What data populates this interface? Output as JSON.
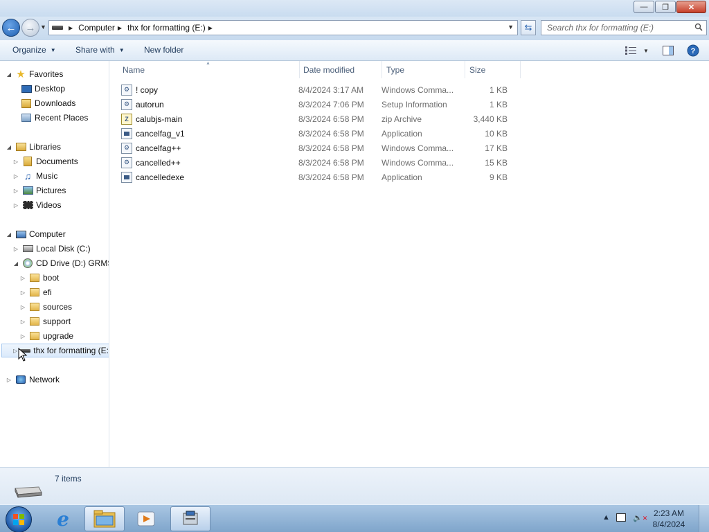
{
  "window": {
    "minimize_glyph": "—",
    "maximize_glyph": "❐",
    "close_glyph": "✕"
  },
  "address": {
    "breadcrumbs": [
      "Computer",
      "thx for formatting (E:)"
    ],
    "search_placeholder": "Search thx for formatting (E:)"
  },
  "toolbar": {
    "organize": "Organize",
    "share_with": "Share with",
    "new_folder": "New folder"
  },
  "nav_tree": {
    "favorites": {
      "label": "Favorites",
      "items": [
        "Desktop",
        "Downloads",
        "Recent Places"
      ]
    },
    "libraries": {
      "label": "Libraries",
      "items": [
        "Documents",
        "Music",
        "Pictures",
        "Videos"
      ]
    },
    "computer": {
      "label": "Computer",
      "local_disk": "Local Disk (C:)",
      "cd_drive": "CD Drive (D:) GRMSX",
      "cd_folders": [
        "boot",
        "efi",
        "sources",
        "support",
        "upgrade"
      ],
      "e_drive": "thx for formatting (E:)"
    },
    "network": "Network"
  },
  "columns": {
    "name": "Name",
    "date": "Date modified",
    "type": "Type",
    "size": "Size"
  },
  "files": [
    {
      "name": "! copy",
      "date": "8/4/2024 3:17 AM",
      "type": "Windows Comma...",
      "size": "1 KB",
      "icon": "cmd-icon"
    },
    {
      "name": "autorun",
      "date": "8/3/2024 7:06 PM",
      "type": "Setup Information",
      "size": "1 KB",
      "icon": "inf-icon"
    },
    {
      "name": "calubjs-main",
      "date": "8/3/2024 6:58 PM",
      "type": "zip Archive",
      "size": "3,440 KB",
      "icon": "zip-icon"
    },
    {
      "name": "cancelfag_v1",
      "date": "8/3/2024 6:58 PM",
      "type": "Application",
      "size": "10 KB",
      "icon": "app-icon"
    },
    {
      "name": "cancelfag++",
      "date": "8/3/2024 6:58 PM",
      "type": "Windows Comma...",
      "size": "17 KB",
      "icon": "cmd-icon"
    },
    {
      "name": "cancelled++",
      "date": "8/3/2024 6:58 PM",
      "type": "Windows Comma...",
      "size": "15 KB",
      "icon": "cmd-icon"
    },
    {
      "name": "cancelledexe",
      "date": "8/3/2024 6:58 PM",
      "type": "Application",
      "size": "9 KB",
      "icon": "app-icon"
    }
  ],
  "details": {
    "count": "7 items"
  },
  "taskbar": {
    "time": "2:23 AM",
    "date": "8/4/2024"
  },
  "colors": {
    "accent": "#1f5fb0",
    "taskbar": "#8fb1d3",
    "selection": "#dbeafb"
  }
}
